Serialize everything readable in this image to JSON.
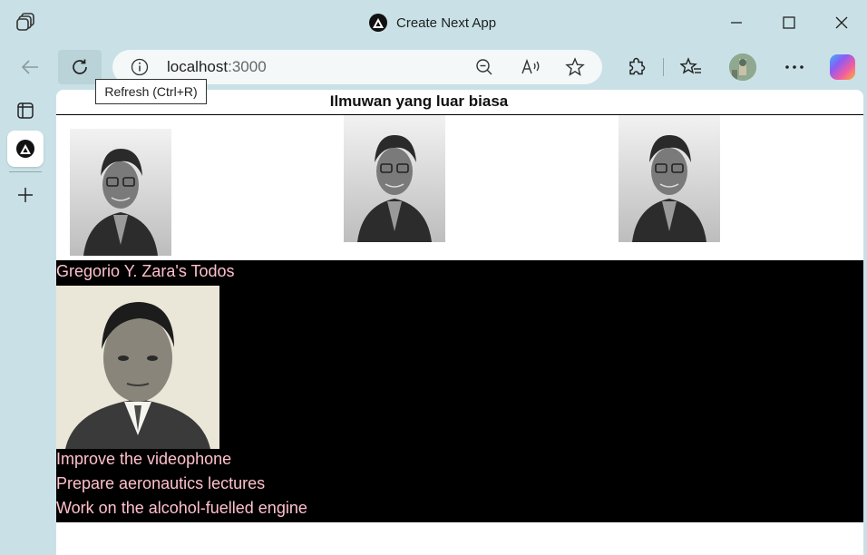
{
  "window": {
    "title": "Create Next App"
  },
  "toolbar": {
    "url_host": "localhost",
    "url_port": ":3000",
    "tooltip": "Refresh (Ctrl+R)"
  },
  "page": {
    "heading": "Ilmuwan yang luar biasa",
    "scientist_images": [
      "katherine-johnson-photo",
      "katherine-johnson-photo",
      "katherine-johnson-photo"
    ],
    "todo_title": "Gregorio Y. Zara's Todos",
    "todos": [
      "Improve the videophone",
      "Prepare aeronautics lectures",
      "Work on the alcohol-fuelled engine"
    ],
    "colors": {
      "todo_text": "#ffc0cb",
      "section_bg": "#000000"
    }
  }
}
